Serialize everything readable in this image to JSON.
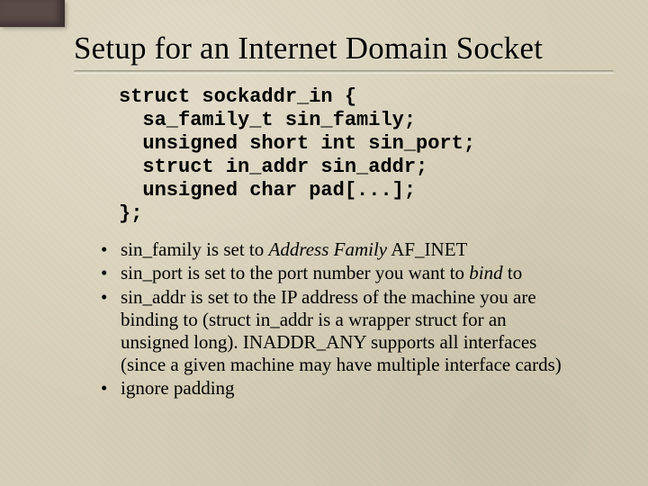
{
  "title": "Setup for an Internet Domain Socket",
  "code": "struct sockaddr_in {\n  sa_family_t sin_family;\n  unsigned short int sin_port;\n  struct in_addr sin_addr;\n  unsigned char pad[...];\n};",
  "bullets": [
    {
      "prefix": "sin_family is set to ",
      "emph": "Address Family",
      "suffix": " AF_INET"
    },
    {
      "prefix": "sin_port is set to the port number you want to ",
      "emph": "bind",
      "suffix": " to"
    },
    {
      "prefix": "sin_addr is set to the IP address of the machine you are binding to (struct in_addr is a wrapper struct for an unsigned long).  INADDR_ANY supports all interfaces (since a given machine may have multiple interface cards)",
      "emph": "",
      "suffix": ""
    },
    {
      "prefix": "ignore padding",
      "emph": "",
      "suffix": ""
    }
  ]
}
